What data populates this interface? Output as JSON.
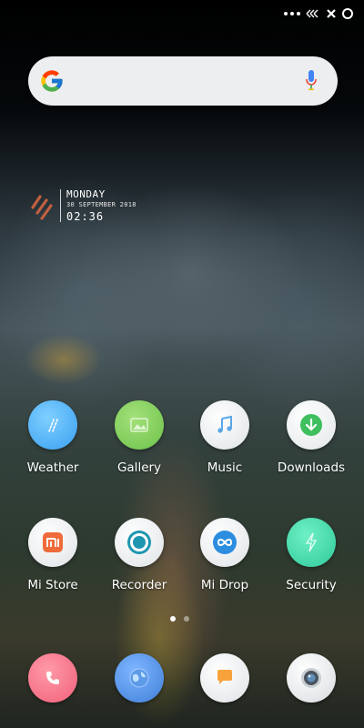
{
  "status_bar": {
    "icons": [
      "notification-dots-icon",
      "data-arrows-icon",
      "no-signal-x-icon",
      "status-circle-icon"
    ]
  },
  "search": {
    "logo": "google-g-icon",
    "mic": "microphone-icon"
  },
  "clock_widget": {
    "day": "MONDAY",
    "date": "30 SEPTEMBER 2018",
    "time": "02:36"
  },
  "apps_row1": [
    {
      "label": "Weather",
      "icon": "weather-icon",
      "color": "#4fb3f3"
    },
    {
      "label": "Gallery",
      "icon": "gallery-icon",
      "color": "#7fcf5a"
    },
    {
      "label": "Music",
      "icon": "music-note-icon",
      "color": "#eef1f3"
    },
    {
      "label": "Downloads",
      "icon": "download-arrow-icon",
      "color": "#45c56a"
    }
  ],
  "apps_row2": [
    {
      "label": "Mi Store",
      "icon": "mi-store-icon",
      "color": "#eef0f1"
    },
    {
      "label": "Recorder",
      "icon": "recorder-icon",
      "color": "#eef0f1"
    },
    {
      "label": "Mi Drop",
      "icon": "mi-drop-icon",
      "color": "#eef0f1"
    },
    {
      "label": "Security",
      "icon": "security-bolt-icon",
      "color": "#3fd4a8"
    }
  ],
  "dock": [
    {
      "icon": "phone-icon",
      "color": "#f36a80"
    },
    {
      "icon": "browser-globe-icon",
      "color": "#4a8de0"
    },
    {
      "icon": "messaging-icon",
      "color": "#eef0f1"
    },
    {
      "icon": "camera-icon",
      "color": "#eef0f1"
    }
  ],
  "page_indicator": {
    "total": 2,
    "active": 1
  }
}
